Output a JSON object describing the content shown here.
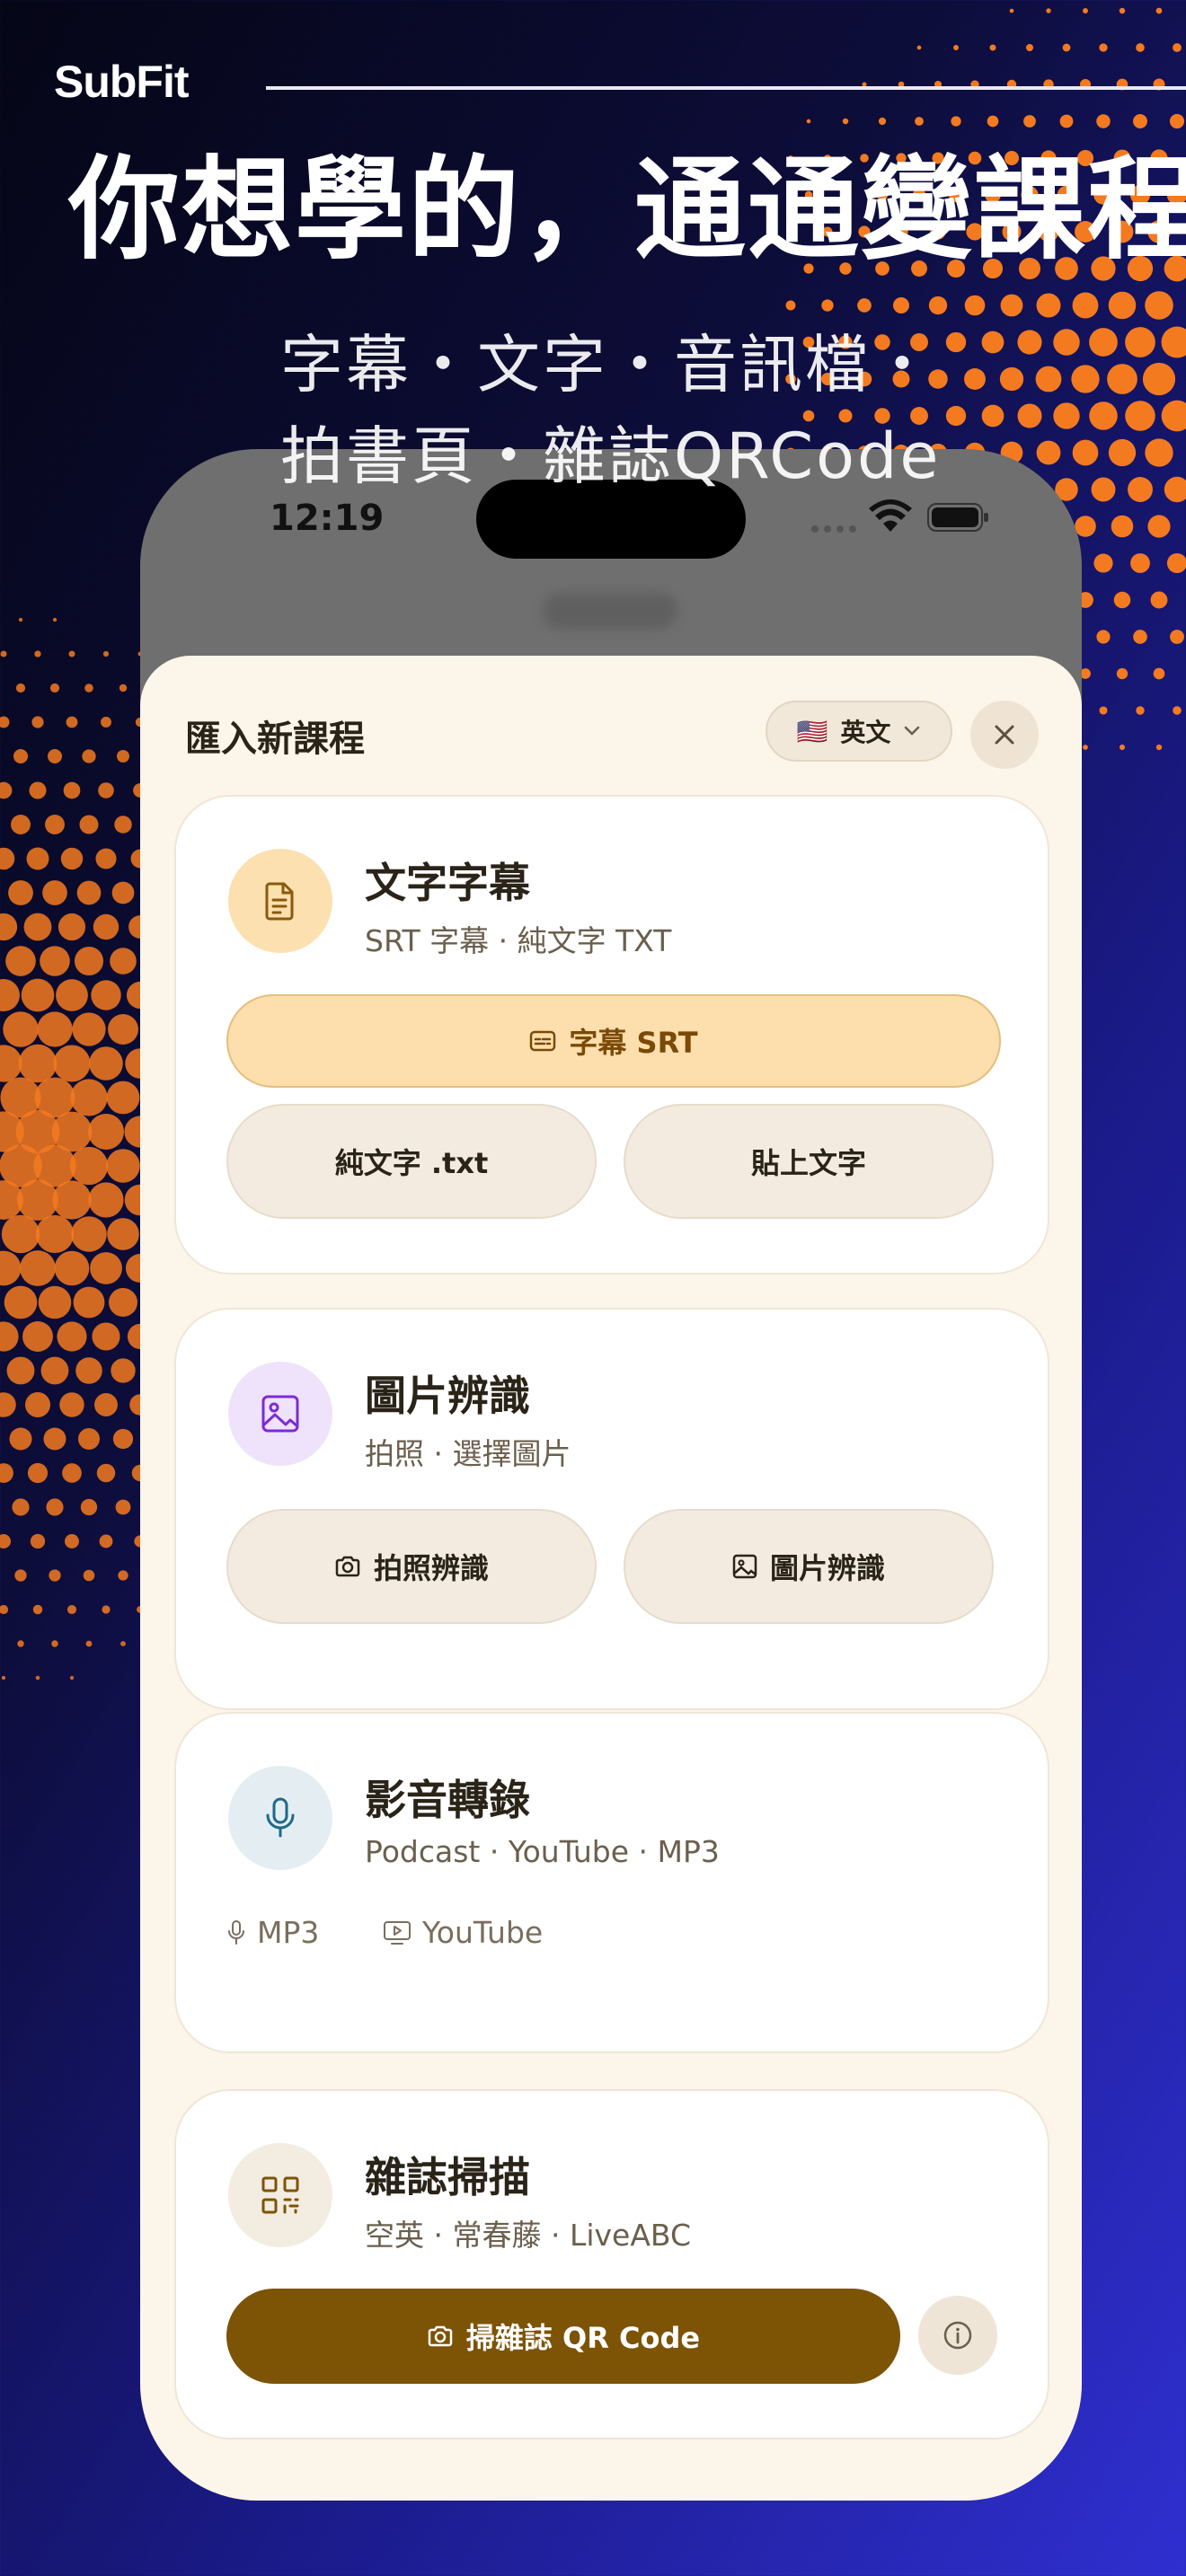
{
  "brand": {
    "logo": "SubFit"
  },
  "headline": "你想學的，通通變課程",
  "subline": [
    "字幕・文字・音訊檔・",
    "拍書頁・雜誌QRCode"
  ],
  "status_bar": {
    "time": "12:19"
  },
  "sheet": {
    "title": "匯入新課程",
    "language": {
      "flag": "🇺🇸",
      "label": "英文"
    },
    "close_icon": "close-icon"
  },
  "cards": {
    "text": {
      "title": "文字字幕",
      "subtitle": "SRT 字幕 · 純文字 TXT",
      "primary_button": "字幕 SRT",
      "button_txt": "純文字 .txt",
      "button_paste": "貼上文字"
    },
    "image": {
      "title": "圖片辨識",
      "subtitle": "拍照 · 選擇圖片",
      "button_camera": "拍照辨識",
      "button_gallery": "圖片辨識"
    },
    "media": {
      "title": "影音轉錄",
      "subtitle": "Podcast · YouTube · MP3",
      "chip_mp3": "MP3",
      "chip_youtube": "YouTube"
    },
    "magazine": {
      "title": "雜誌掃描",
      "subtitle": "空英 · 常春藤 · LiveABC",
      "scan_button": "掃雜誌 QR Code"
    }
  },
  "colors": {
    "background_dark": "#050616",
    "background_blue": "#2f2fd0",
    "dots": "#f47a20",
    "sheet": "#fcf5e9",
    "accent": "#7d5305",
    "primary_button": "#fddfae"
  }
}
